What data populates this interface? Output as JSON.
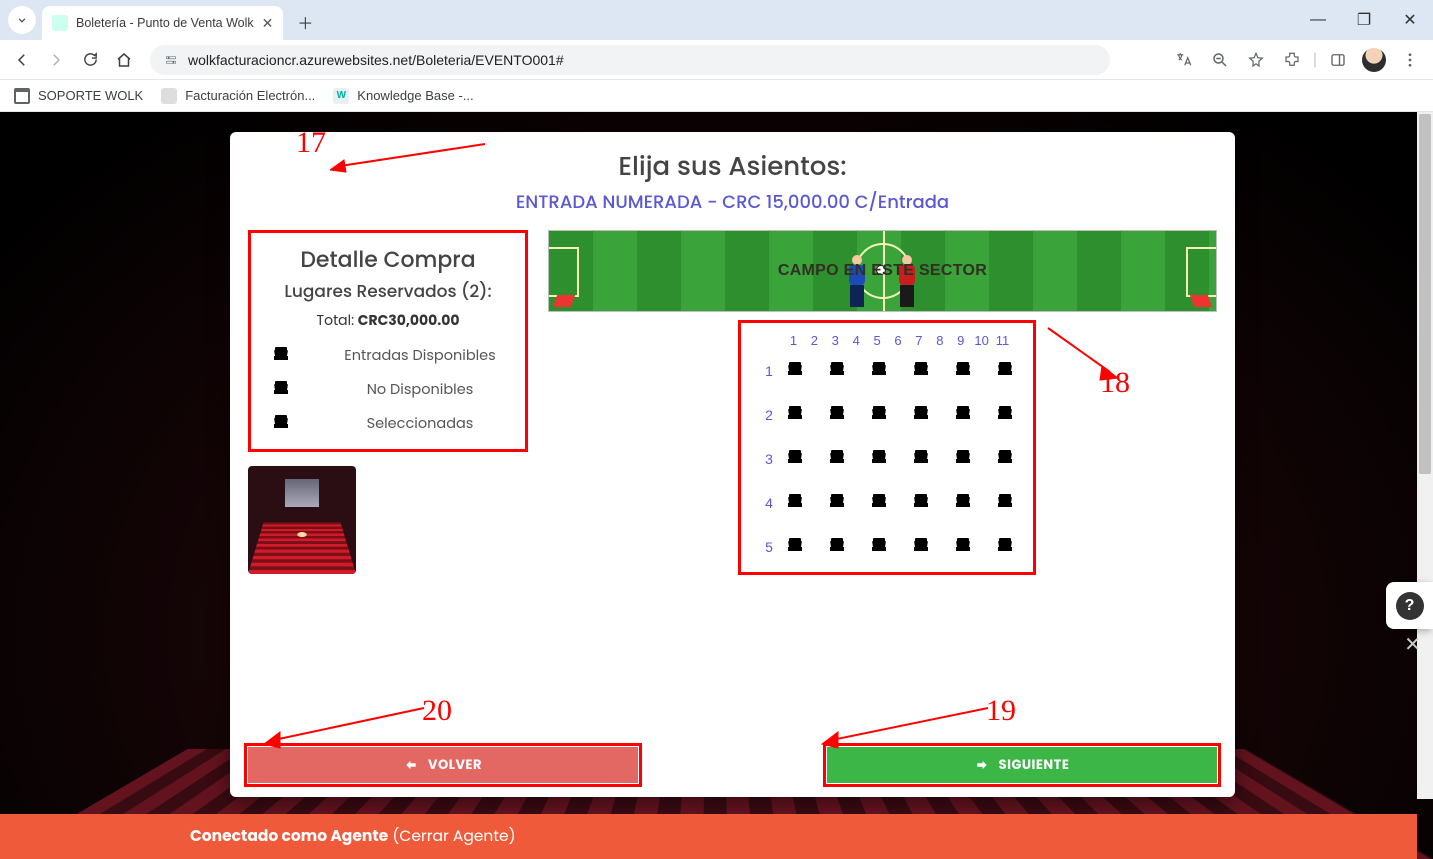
{
  "browser": {
    "tab_title": "Boletería - Punto de Venta Wolk",
    "url_display": "wolkfacturacioncr.azurewebsites.net/Boleteria/EVENTO001#",
    "bookmarks": [
      "SOPORTE WOLK",
      "Facturación Electrón...",
      "Knowledge Base -..."
    ]
  },
  "page": {
    "title": "Elija sus Asientos:",
    "subtitle": "ENTRADA NUMERADA - CRC 15,000.00 C/Entrada",
    "pitch_label": "CAMPO EN ESTE SECTOR"
  },
  "purchase": {
    "title": "Detalle Compra",
    "reserved_label": "Lugares Reservados (2):",
    "total_label": "Total: ",
    "total_value": "CRC30,000.00",
    "legend": {
      "available": "Entradas Disponibles",
      "unavailable": "No Disponibles",
      "selected": "Seleccionadas"
    }
  },
  "seating": {
    "column_labels": [
      "1",
      "2",
      "3",
      "4",
      "5",
      "6",
      "7",
      "8",
      "9",
      "10",
      "11"
    ],
    "row_labels": [
      "1",
      "2",
      "3",
      "4",
      "5"
    ],
    "cols_shown": 6,
    "grid": [
      [
        "sel",
        "sel",
        "avail",
        "avail",
        "avail",
        "avail"
      ],
      [
        "avail",
        "avail",
        "avail",
        "avail",
        "avail",
        "avail"
      ],
      [
        "avail",
        "avail",
        "avail",
        "avail",
        "avail",
        "avail"
      ],
      [
        "avail",
        "avail",
        "avail",
        "avail",
        "avail",
        "avail"
      ],
      [
        "avail",
        "avail",
        "avail",
        "avail",
        "avail",
        "avail"
      ]
    ]
  },
  "buttons": {
    "back": "VOLVER",
    "next": "SIGUIENTE"
  },
  "agent_bar": {
    "prefix": "Conectado como Agente",
    "link": "(Cerrar Agente)"
  },
  "annotations": {
    "n17": "17",
    "n18": "18",
    "n19": "19",
    "n20": "20"
  }
}
